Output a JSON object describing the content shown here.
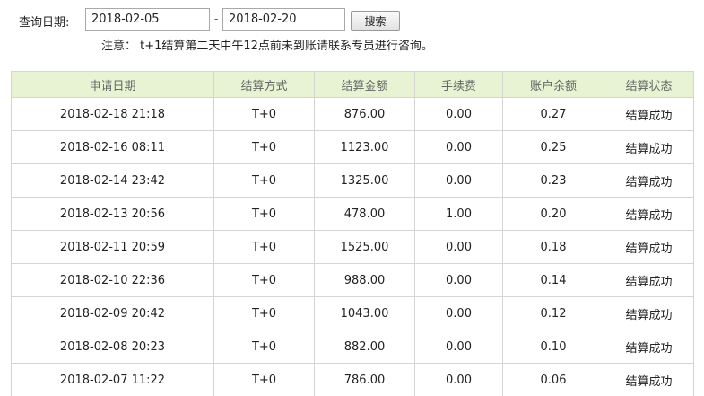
{
  "search": {
    "label": "查询日期:",
    "start_date": "2018-02-05",
    "separator": "-",
    "end_date": "2018-02-20",
    "button_label": "搜索"
  },
  "notice": "注意：  t+1结算第二天中午12点前未到账请联系专员进行咨询。",
  "table": {
    "headers": [
      "申请日期",
      "结算方式",
      "结算金额",
      "手续费",
      "账户余额",
      "结算状态"
    ],
    "rows": [
      [
        "2018-02-18 21:18",
        "T+0",
        "876.00",
        "0.00",
        "0.27",
        "结算成功"
      ],
      [
        "2018-02-16 08:11",
        "T+0",
        "1123.00",
        "0.00",
        "0.25",
        "结算成功"
      ],
      [
        "2018-02-14 23:42",
        "T+0",
        "1325.00",
        "0.00",
        "0.23",
        "结算成功"
      ],
      [
        "2018-02-13 20:56",
        "T+0",
        "478.00",
        "1.00",
        "0.20",
        "结算成功"
      ],
      [
        "2018-02-11 20:59",
        "T+0",
        "1525.00",
        "0.00",
        "0.18",
        "结算成功"
      ],
      [
        "2018-02-10 22:36",
        "T+0",
        "988.00",
        "0.00",
        "0.14",
        "结算成功"
      ],
      [
        "2018-02-09 20:42",
        "T+0",
        "1043.00",
        "0.00",
        "0.12",
        "结算成功"
      ],
      [
        "2018-02-08 20:23",
        "T+0",
        "882.00",
        "0.00",
        "0.10",
        "结算成功"
      ],
      [
        "2018-02-07 11:22",
        "T+0",
        "786.00",
        "0.00",
        "0.06",
        "结算成功"
      ]
    ]
  },
  "colors": {
    "header_background": "#e8f3d4",
    "border": "#d4d4d4",
    "header_text": "#666666"
  }
}
